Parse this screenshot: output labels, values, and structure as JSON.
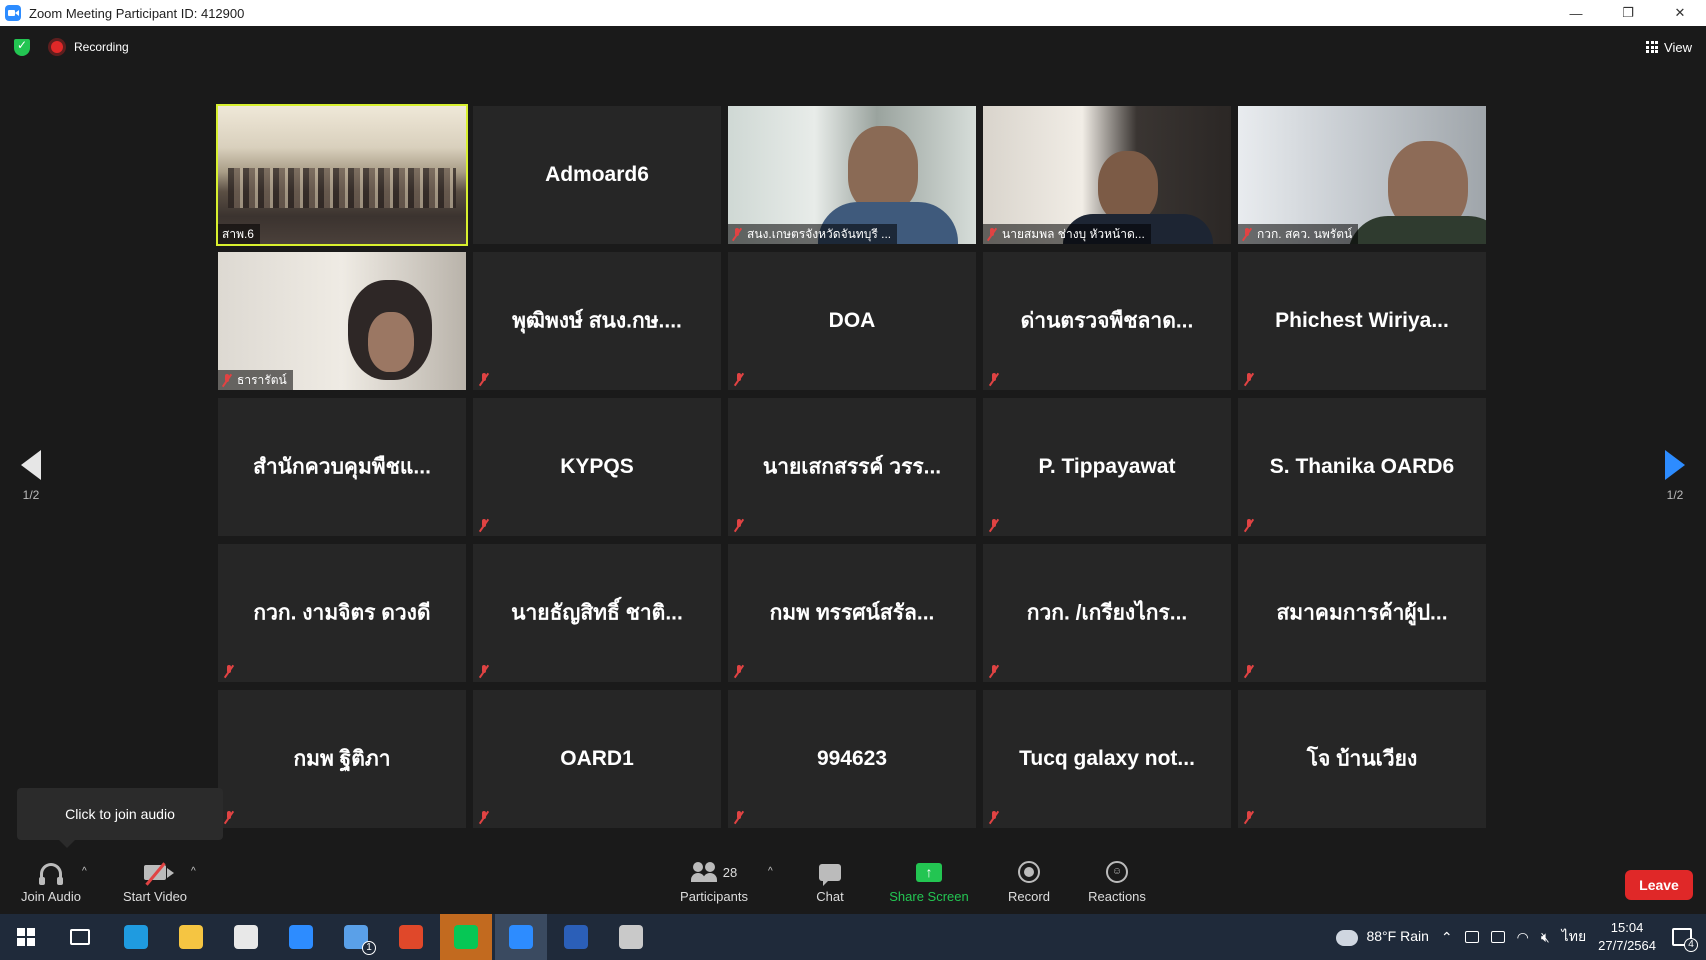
{
  "window": {
    "title": "Zoom Meeting Participant ID: 412900",
    "controls": [
      "—",
      "❐",
      "✕"
    ]
  },
  "topbar": {
    "recording_label": "Recording",
    "view_label": "View"
  },
  "pagination": {
    "left": "1/2",
    "right": "1/2"
  },
  "tiles": [
    {
      "name": "สาพ.6",
      "video": true,
      "muted": false,
      "active": true,
      "vid_class": "vid-hall"
    },
    {
      "name": "Admoard6",
      "video": false,
      "muted": false
    },
    {
      "name": "สนง.เกษตรจังหวัดจันทบุรี ...",
      "video": true,
      "muted": true,
      "vid_class": "vid-man1"
    },
    {
      "name": "นายสมพล ช่างบุ หัวหน้าด...",
      "video": true,
      "muted": true,
      "vid_class": "vid-man2"
    },
    {
      "name": "กวก. สคว. นพรัตน์",
      "video": true,
      "muted": true,
      "vid_class": "vid-man3"
    },
    {
      "name": "ธารารัตน์",
      "video": true,
      "muted": true,
      "vid_class": "vid-woman"
    },
    {
      "name": "พุฒิพงษ์ สนง.กษ....",
      "video": false,
      "muted": true
    },
    {
      "name": "DOA",
      "video": false,
      "muted": true
    },
    {
      "name": "ด่านตรวจพืชลาด...",
      "video": false,
      "muted": true
    },
    {
      "name": "Phichest  Wiriya...",
      "video": false,
      "muted": true
    },
    {
      "name": "สำนักควบคุมพืชแ...",
      "video": false,
      "muted": false
    },
    {
      "name": "KYPQS",
      "video": false,
      "muted": true
    },
    {
      "name": "นายเสกสรรค์ วรร...",
      "video": false,
      "muted": true
    },
    {
      "name": "P. Tippayawat",
      "video": false,
      "muted": true
    },
    {
      "name": "S. Thanika OARD6",
      "video": false,
      "muted": true
    },
    {
      "name": "กวก. งามจิตร ดวงดี",
      "video": false,
      "muted": true
    },
    {
      "name": "นายธัญสิทธิ์  ชาติ...",
      "video": false,
      "muted": true
    },
    {
      "name": "กมพ ทรรศน์สรัล...",
      "video": false,
      "muted": true
    },
    {
      "name": "กวก. /เกรียงไกร...",
      "video": false,
      "muted": true
    },
    {
      "name": "สมาคมการค้าผู้ป...",
      "video": false,
      "muted": true
    },
    {
      "name": "กมพ ฐิติภา",
      "video": false,
      "muted": true
    },
    {
      "name": "OARD1",
      "video": false,
      "muted": true
    },
    {
      "name": "994623",
      "video": false,
      "muted": true
    },
    {
      "name": "Tucq galaxy not...",
      "video": false,
      "muted": true
    },
    {
      "name": "โจ บ้านเวียง",
      "video": false,
      "muted": true
    }
  ],
  "tooltip": {
    "text": "Click to join audio"
  },
  "toolbar": {
    "join_audio": "Join Audio",
    "start_video": "Start Video",
    "participants": "Participants",
    "participant_count": "28",
    "chat": "Chat",
    "share_screen": "Share Screen",
    "record": "Record",
    "reactions": "Reactions",
    "leave": "Leave",
    "caret": "^"
  },
  "taskbar": {
    "weather": "88°F  Rain",
    "language": "ไทย",
    "time": "15:04",
    "date": "27/7/2564",
    "mail_badge": "1",
    "notification_badge": "4",
    "app_icons": [
      {
        "name": "edge-icon",
        "color": "#1f9be0"
      },
      {
        "name": "file-explorer-icon",
        "color": "#f5c542"
      },
      {
        "name": "store-icon",
        "color": "#e8e8e8"
      },
      {
        "name": "lumin-icon",
        "color": "#2d8cff"
      },
      {
        "name": "mail-icon",
        "color": "#5aa0e8"
      },
      {
        "name": "office-icon",
        "color": "#e0482a"
      },
      {
        "name": "line-icon",
        "color": "#06c755"
      },
      {
        "name": "zoom-icon",
        "color": "#2d8cff"
      },
      {
        "name": "word-icon",
        "color": "#2b5fb8"
      },
      {
        "name": "people-search-icon",
        "color": "#c9c9c9"
      }
    ]
  },
  "colors": {
    "accent": "#2d8cff",
    "active_speaker": "#d8f02e",
    "leave": "#e02828",
    "share": "#23c552",
    "muted": "#e04343"
  }
}
